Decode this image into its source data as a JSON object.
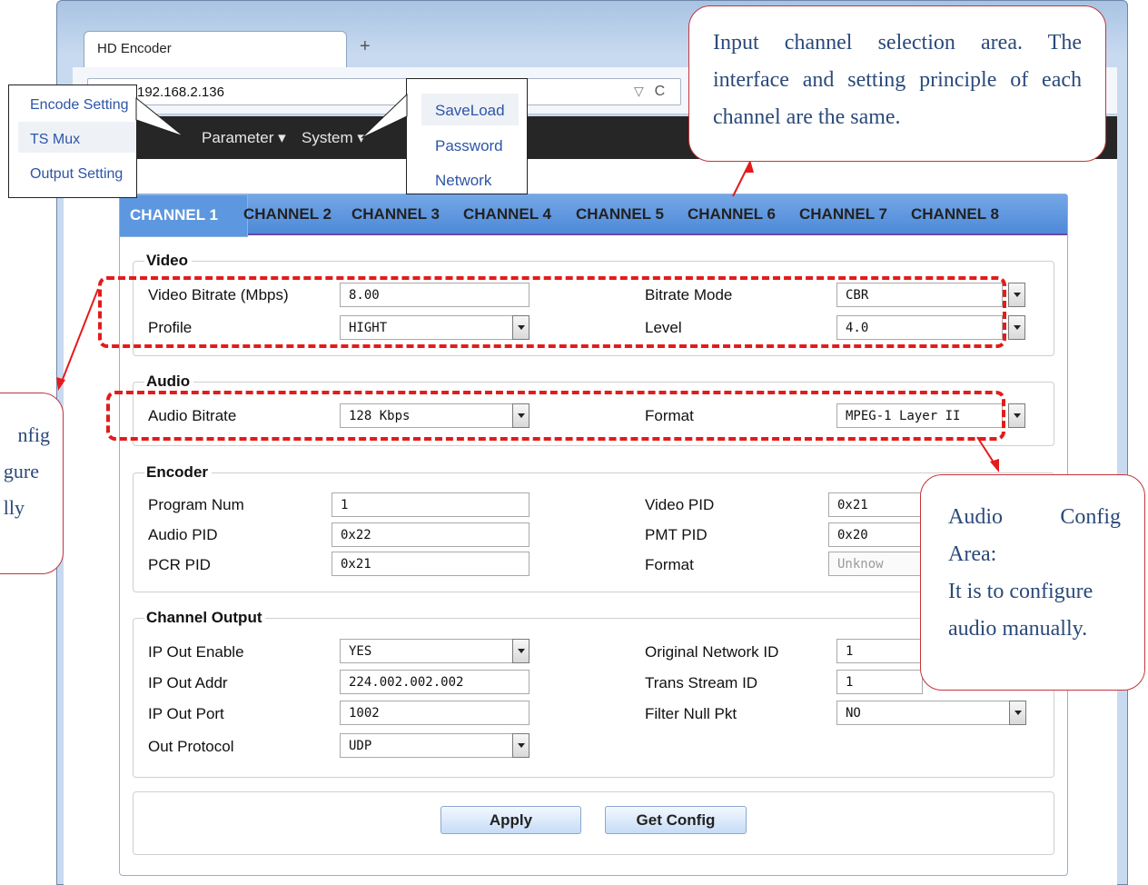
{
  "browser": {
    "tab_title": "HD Encoder",
    "new_tab": "+",
    "address": "192.168.2.136",
    "address_controls": "▽",
    "refresh": "C"
  },
  "nav": {
    "parameter": "Parameter ▾",
    "system": "System ▾"
  },
  "parameter_menu": [
    "Encode Setting",
    "TS Mux",
    "Output Setting"
  ],
  "system_menu": [
    "SaveLoad",
    "Password",
    "Network"
  ],
  "channel_tabs": [
    "CHANNEL 1",
    "CHANNEL 2",
    "CHANNEL 3",
    "CHANNEL 4",
    "CHANNEL 5",
    "CHANNEL 6",
    "CHANNEL 7",
    "CHANNEL 8"
  ],
  "video": {
    "legend": "Video",
    "bitrate_label": "Video Bitrate (Mbps)",
    "bitrate_value": "8.00",
    "mode_label": "Bitrate Mode",
    "mode_value": "CBR",
    "profile_label": "Profile",
    "profile_value": "HIGHT",
    "level_label": "Level",
    "level_value": "4.0"
  },
  "audio": {
    "legend": "Audio",
    "bitrate_label": "Audio Bitrate",
    "bitrate_value": "128 Kbps",
    "format_label": "Format",
    "format_value": "MPEG-1 Layer II"
  },
  "encoder": {
    "legend": "Encoder",
    "program_num_label": "Program Num",
    "program_num_value": "1",
    "video_pid_label": "Video PID",
    "video_pid_value": "0x21",
    "audio_pid_label": "Audio PID",
    "audio_pid_value": "0x22",
    "pmt_pid_label": "PMT PID",
    "pmt_pid_value": "0x20",
    "pcr_pid_label": "PCR PID",
    "pcr_pid_value": "0x21",
    "format_label": "Format",
    "format_value": "Unknow"
  },
  "output": {
    "legend": "Channel Output",
    "ip_enable_label": "IP Out Enable",
    "ip_enable_value": "YES",
    "onid_label": "Original Network ID",
    "onid_value": "1",
    "ip_addr_label": "IP Out Addr",
    "ip_addr_value": "224.002.002.002",
    "tsid_label": "Trans Stream ID",
    "tsid_value": "1",
    "ip_port_label": "IP Out Port",
    "ip_port_value": "1002",
    "filter_label": "Filter Null Pkt",
    "filter_value": "NO",
    "protocol_label": "Out Protocol",
    "protocol_value": "UDP"
  },
  "buttons": {
    "apply": "Apply",
    "get_config": "Get Config"
  },
  "callouts": {
    "input_channel": "Input channel selection area. The interface and setting principle of each channel are the same.",
    "audio_config": [
      "Audio",
      "Config",
      "Area:",
      "It is to configure",
      "audio manually."
    ],
    "video_config_partial": [
      "nfig",
      "gure",
      "lly"
    ]
  },
  "colors": {
    "accent": "#5d97df",
    "nav_bg": "#262626",
    "highlight": "#e31b1b",
    "callout_text": "#2a4a7a",
    "menu_link": "#2d55a8"
  }
}
